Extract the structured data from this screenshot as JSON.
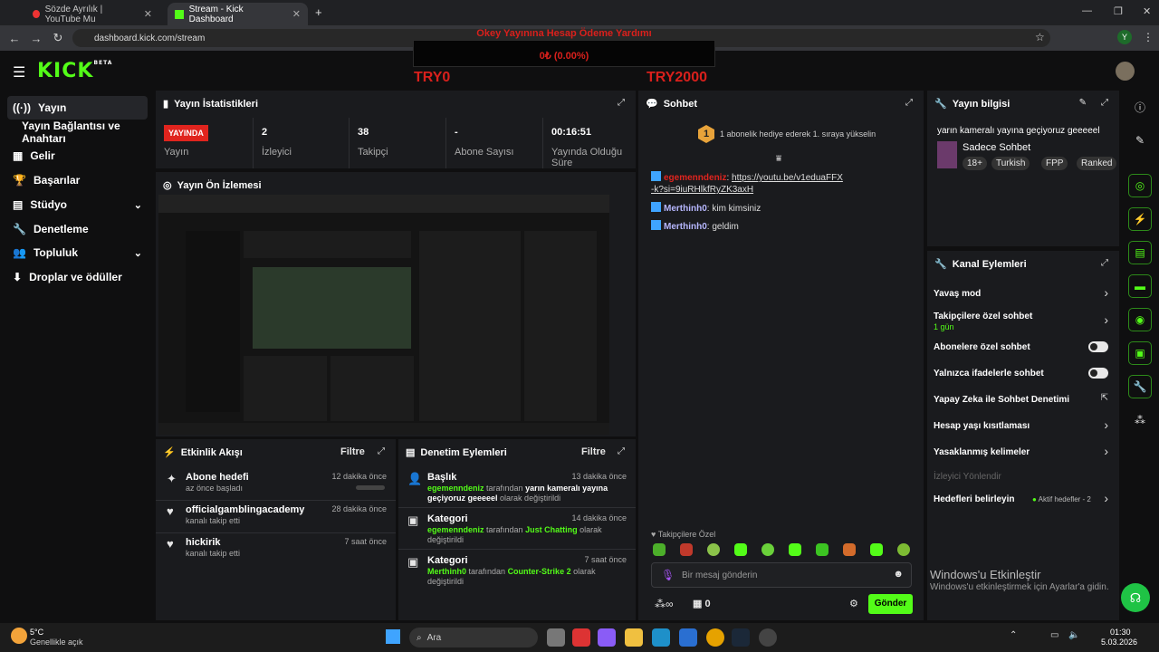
{
  "browser": {
    "tab1": "Sözde Ayrılık | YouTube Mu",
    "tab2": "Stream - Kick Dashboard",
    "url": "dashboard.kick.com/stream",
    "profile": "Y"
  },
  "overlay": {
    "title": "Okey Yayınına Hesap Ödeme Yardımı",
    "amount": "0₺ (0.00%)",
    "left": "TRY0",
    "right": "TRY2000"
  },
  "header": {
    "logo": "KICK",
    "beta": "BETA"
  },
  "sidebar": {
    "items": [
      "Yayın",
      "Yayın Bağlantısı ve Anahtarı",
      "Gelir",
      "Başarılar",
      "Stüdyo",
      "Denetleme",
      "Topluluk",
      "Droplar ve ödüller"
    ]
  },
  "stats": {
    "title": "Yayın İstatistikleri",
    "live": "YAYINDA",
    "c1": "Yayın",
    "v2": "2",
    "c2": "İzleyici",
    "v3": "38",
    "c3": "Takipçi",
    "v4": "-",
    "c4": "Abone Sayısı",
    "v5": "00:16:51",
    "c5": "Yayında Olduğu Süre"
  },
  "preview": {
    "title": "Yayın Ön İzlemesi"
  },
  "activity": {
    "title": "Etkinlik Akışı",
    "filter": "Filtre",
    "items": [
      {
        "t": "Abone hedefi",
        "s": "az önce başladı",
        "time": "12 dakika önce"
      },
      {
        "t": "officialgamblingacademy",
        "s": "kanalı takip etti",
        "time": "28 dakika önce"
      },
      {
        "t": "hickirik",
        "s": "kanalı takip etti",
        "time": "7 saat önce"
      }
    ]
  },
  "moderation": {
    "title": "Denetim Eylemleri",
    "filter": "Filtre",
    "items": [
      {
        "t": "Başlık",
        "time": "13 dakika önce",
        "u": "egemenndeniz",
        "a": " tarafından ",
        "v": "yarın kameralı yayına geçiyoruz geeeeel",
        "e": " olarak değiştirildi"
      },
      {
        "t": "Kategori",
        "time": "14 dakika önce",
        "u": "egemenndeniz",
        "a": " tarafından ",
        "v": "Just Chatting",
        "e": " olarak değiştirildi"
      },
      {
        "t": "Kategori",
        "time": "7 saat önce",
        "u": "Merthinh0",
        "a": " tarafından ",
        "v": "Counter-Strike 2",
        "e": " olarak değiştirildi"
      }
    ]
  },
  "chat": {
    "title": "Sohbet",
    "gift": "1 abonelik hediye ederek 1. sıraya yükselin",
    "giftnum": "1",
    "messages": [
      {
        "u": "egemenndeniz",
        "m": "https://youtu.be/v1eduaFFX-k?si=9iuRHlkfRyZK3axH"
      },
      {
        "u": "Merthinh0",
        "m": "kim kimsiniz"
      },
      {
        "u": "Merthinh0",
        "m": "geldim"
      }
    ],
    "followers": "Takipçilere Özel",
    "placeholder": "Bir mesaj gönderin",
    "count": "0",
    "send": "Gönder",
    "inf": "∞"
  },
  "info": {
    "title": "Yayın bilgisi",
    "stream_title": "yarın kameralı yayına geçiyoruz geeeeel",
    "category": "Sadece Sohbet",
    "tags": [
      "18+",
      "Turkish",
      "FPP",
      "Ranked"
    ]
  },
  "actions": {
    "title": "Kanal Eylemleri",
    "slow": "Yavaş mod",
    "followers": "Takipçilere özel sohbet",
    "followers_sub": "1 gün",
    "subs": "Abonelere özel sohbet",
    "emotes": "Yalnızca ifadelerle sohbet",
    "ai": "Yapay Zeka ile Sohbet Denetimi",
    "age": "Hesap yaşı kısıtlaması",
    "banned": "Yasaklanmış kelimeler",
    "viewer": "İzleyici Yönlendir",
    "goals": "Hedefleri belirleyin",
    "goals_sub": "Aktif hedefler - 2"
  },
  "windows": {
    "activate": "Windows'u Etkinleştir",
    "activate_sub": "Windows'u etkinleştirmek için Ayarlar'a gidin.",
    "temp": "5°C",
    "weather": "Genellikle açık",
    "search": "Ara",
    "time": "01:30",
    "date": "5.03.2026"
  }
}
